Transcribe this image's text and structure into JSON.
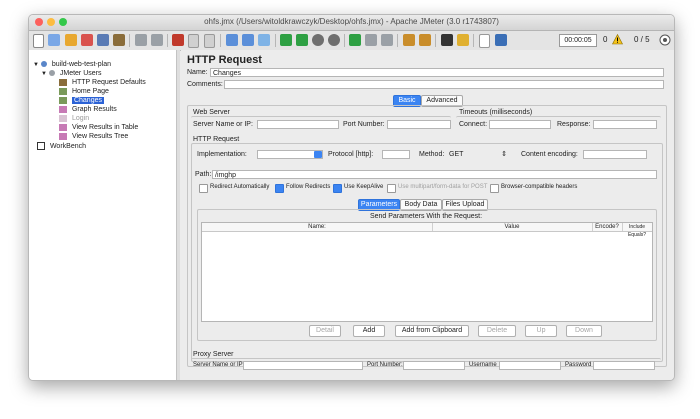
{
  "window": {
    "title": "ohfs.jmx (/Users/witoldkrawczyk/Desktop/ohfs.jmx) - Apache JMeter (3.0 r1743807)"
  },
  "toolbar": {
    "timer": "00:00:05",
    "warnings_count": "0",
    "threads": "0 / 5"
  },
  "tree": {
    "items": [
      {
        "label": "build-web-test-plan",
        "icon": "test-plan-icon"
      },
      {
        "label": "JMeter Users",
        "icon": "thread-group-icon"
      },
      {
        "label": "HTTP Request Defaults",
        "icon": "config-defaults-icon"
      },
      {
        "label": "Home Page",
        "icon": "sampler-icon"
      },
      {
        "label": "Changes",
        "icon": "sampler-icon"
      },
      {
        "label": "Graph Results",
        "icon": "listener-icon"
      },
      {
        "label": "Login",
        "icon": "sampler-disabled-icon"
      },
      {
        "label": "View Results in Table",
        "icon": "listener-icon"
      },
      {
        "label": "View Results Tree",
        "icon": "listener-icon"
      },
      {
        "label": "WorkBench",
        "icon": "workbench-icon"
      }
    ]
  },
  "panel": {
    "title": "HTTP Request",
    "name_label": "Name:",
    "name_value": "Changes",
    "comments_label": "Comments:",
    "comments_value": "",
    "tabs": [
      "Basic",
      "Advanced"
    ],
    "web_server": {
      "legend": "Web Server",
      "server_label": "Server Name or IP:",
      "server_value": "",
      "port_label": "Port Number:",
      "port_value": ""
    },
    "timeouts": {
      "legend": "Timeouts (milliseconds)",
      "connect_label": "Connect:",
      "connect_value": "",
      "response_label": "Response:",
      "response_value": ""
    },
    "http_request": {
      "legend": "HTTP Request",
      "impl_label": "Implementation:",
      "impl_value": "",
      "protocol_label": "Protocol [http]:",
      "protocol_value": "",
      "method_label": "Method:",
      "method_value": "GET",
      "encoding_label": "Content encoding:",
      "encoding_value": "",
      "path_label": "Path:",
      "path_value": "/imghp",
      "checkboxes": [
        {
          "label": "Redirect Automatically",
          "checked": false
        },
        {
          "label": "Follow Redirects",
          "checked": true
        },
        {
          "label": "Use KeepAlive",
          "checked": true
        },
        {
          "label": "Use multipart/form-data for POST",
          "checked": false
        },
        {
          "label": "Browser-compatible headers",
          "checked": false
        }
      ]
    },
    "param_tabs": [
      "Parameters",
      "Body Data",
      "Files Upload"
    ],
    "params_table": {
      "title": "Send Parameters With the Request:",
      "columns": [
        "Name:",
        "Value",
        "Encode?",
        "Include Equals?"
      ]
    },
    "buttons": {
      "detail": "Detail",
      "add": "Add",
      "add_clipboard": "Add from Clipboard",
      "delete": "Delete",
      "up": "Up",
      "down": "Down"
    },
    "proxy": {
      "legend": "Proxy Server",
      "server_label": "Server Name or IP:",
      "port_label": "Port Number:",
      "username_label": "Username",
      "password_label": "Password"
    }
  },
  "colors": {
    "accent": "#3b84f2",
    "selection": "#2b62d6"
  }
}
